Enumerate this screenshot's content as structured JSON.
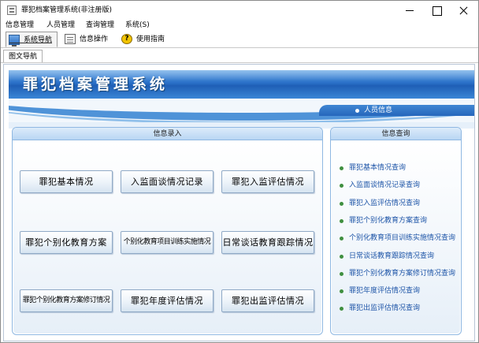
{
  "window": {
    "title": "罪犯档案管理系统(非注册版)"
  },
  "menu": [
    "信息管理",
    "人员管理",
    "查询管理",
    "系统(S)"
  ],
  "toolbar": [
    {
      "label": "系统导航",
      "icon": "monitor-icon",
      "active": true
    },
    {
      "label": "信息操作",
      "icon": "document-icon",
      "active": false
    },
    {
      "label": "使用指南",
      "icon": "help-icon",
      "active": false
    }
  ],
  "subtab": {
    "label": "图文导航"
  },
  "header": {
    "title": "罪犯档案管理系统",
    "info": "人员信息"
  },
  "colors": {
    "banner": "#2a70c8",
    "accent": "#4f93d8",
    "link": "#1f56a8",
    "bullet": "#3f8f3f"
  },
  "entry_panel": {
    "title": "信息录入",
    "buttons": [
      "罪犯基本情况",
      "入监面谈情况记录",
      "罪犯入监评估情况",
      "罪犯个别化教育方案",
      "个别化教育项目训练实施情况",
      "日常谈话教育跟踪情况",
      "罪犯个别化教育方案修订情况",
      "罪犯年度评估情况",
      "罪犯出监评估情况"
    ]
  },
  "query_panel": {
    "title": "信息查询",
    "links": [
      "罪犯基本情况查询",
      "入监面谈情况记录查询",
      "罪犯入监评估情况查询",
      "罪犯个别化教育方案查询",
      "个别化教育项目训练实施情况查询",
      "日常谈话教育跟踪情况查询",
      "罪犯个别化教育方案修订情况查询",
      "罪犯年度评估情况查询",
      "罪犯出监评估情况查询"
    ]
  }
}
